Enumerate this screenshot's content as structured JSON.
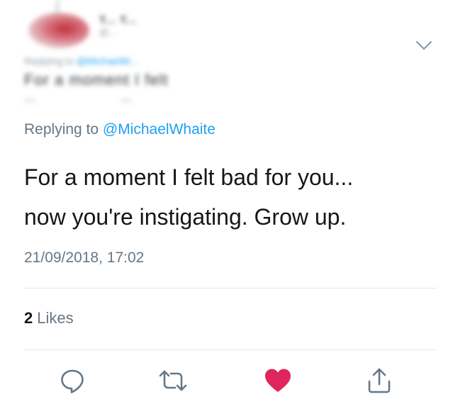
{
  "parent_tweet": {
    "name": "T... T...",
    "handle": "@...",
    "replying_prefix": "Replying to",
    "replying_mention": "@MichaelW...",
    "text": "For a moment I felt",
    "state": "blurred"
  },
  "tweet": {
    "replying_prefix": "Replying to",
    "replying_mention": "@MichaelWhaite",
    "text_lines": [
      "For a moment I felt bad for you...",
      "now you're instigating. Grow up."
    ],
    "timestamp": "21/09/2018, 17:02",
    "likes_count": "2",
    "likes_label": "Likes"
  },
  "actions": {
    "icons": [
      "reply-icon",
      "retweet-icon",
      "like-icon",
      "share-icon"
    ],
    "like_active": true
  },
  "colors": {
    "accent": "#1da1f2",
    "secondary_text": "#657786",
    "like": "#e0245e",
    "icon": "#657786",
    "divider": "#e1e8ed"
  }
}
